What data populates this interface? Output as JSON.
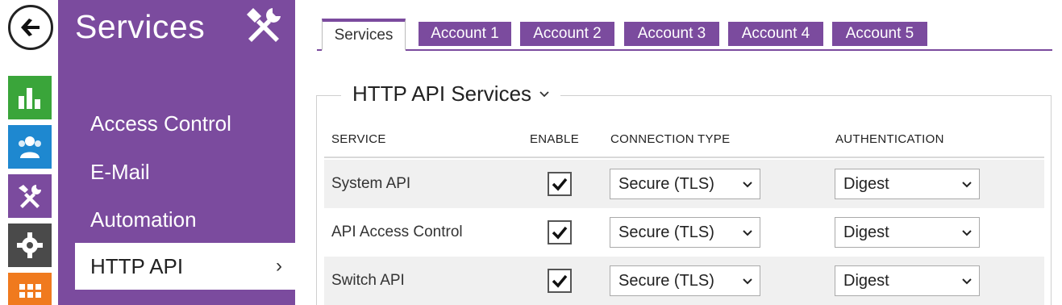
{
  "sidebar": {
    "title": "Services",
    "items": [
      {
        "label": "Access Control"
      },
      {
        "label": "E-Mail"
      },
      {
        "label": "Automation"
      },
      {
        "label": "HTTP API",
        "active": true
      }
    ]
  },
  "rail": {
    "icons": [
      "back-arrow-icon",
      "status-chart-icon",
      "directory-users-icon",
      "services-tools-icon",
      "hardware-gear-icon",
      "system-grid-icon"
    ],
    "colors": {
      "green": "#3aa53a",
      "blue": "#1e88d0",
      "purple": "#7b4b9e",
      "gray": "#4a4a4a",
      "orange": "#f07a1e"
    }
  },
  "tabs": [
    {
      "label": "Services",
      "active": true
    },
    {
      "label": "Account 1"
    },
    {
      "label": "Account 2"
    },
    {
      "label": "Account 3"
    },
    {
      "label": "Account 4"
    },
    {
      "label": "Account 5"
    }
  ],
  "section": {
    "title": "HTTP API Services",
    "columns": {
      "service": "SERVICE",
      "enable": "ENABLE",
      "connection": "CONNECTION TYPE",
      "auth": "AUTHENTICATION"
    },
    "rows": [
      {
        "service": "System API",
        "enabled": true,
        "connection": "Secure (TLS)",
        "auth": "Digest"
      },
      {
        "service": "API Access Control",
        "enabled": true,
        "connection": "Secure (TLS)",
        "auth": "Digest"
      },
      {
        "service": "Switch API",
        "enabled": true,
        "connection": "Secure (TLS)",
        "auth": "Digest"
      }
    ]
  },
  "theme": {
    "accent": "#7b4b9e"
  }
}
